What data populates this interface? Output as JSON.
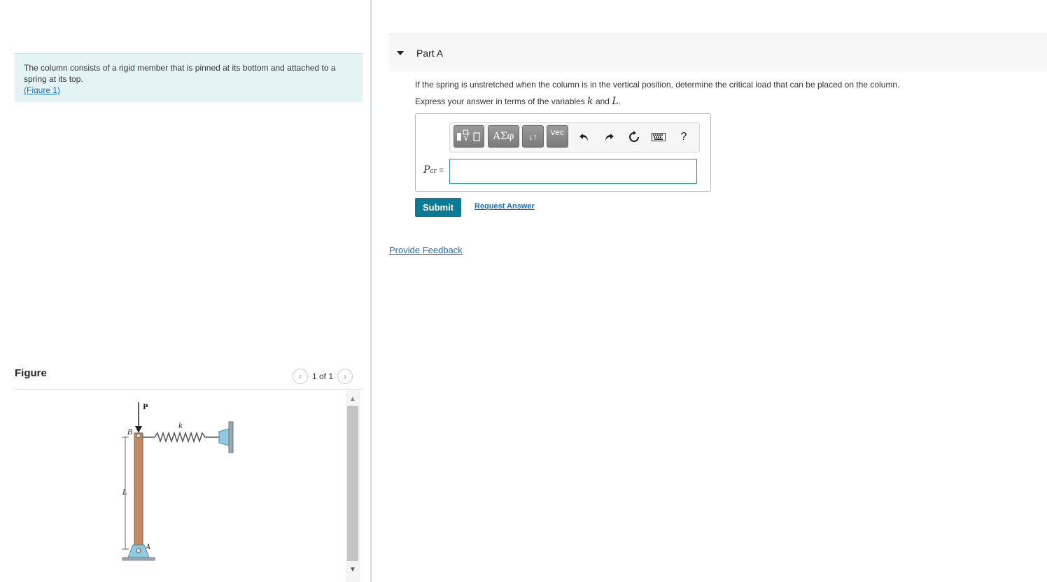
{
  "problem": {
    "text": "The column consists of a rigid member that is pinned at its bottom and attached to a spring at its top.",
    "figure_link": "(Figure 1)"
  },
  "figure": {
    "title": "Figure",
    "page_indicator": "1 of 1",
    "labels": {
      "P": "P",
      "B": "B",
      "k": "k",
      "L": "L",
      "A": "A"
    }
  },
  "part": {
    "title": "Part A",
    "question": "If the spring is unstretched when the column is in the vertical position, determine the critical load that can be placed on the column.",
    "express_prefix": "Express your answer in terms of the variables",
    "var1": "k",
    "and_word": "and",
    "var2": "L",
    "period": ".",
    "answer_label_P": "P",
    "answer_label_sub": "cr",
    "answer_label_eq": " =",
    "answer_value": ""
  },
  "toolbar": {
    "templates_icon": "sqrt-template-icon",
    "greek_label": "ΑΣφ",
    "arrows_label": "↓↑",
    "vec_label": "vec",
    "undo_icon": "undo-icon",
    "redo_icon": "redo-icon",
    "reset_icon": "reset-icon",
    "keyboard_icon": "keyboard-icon",
    "help_label": "?"
  },
  "actions": {
    "submit": "Submit",
    "request_answer": "Request Answer",
    "provide_feedback": "Provide Feedback"
  },
  "colors": {
    "accent": "#0b7a94",
    "link": "#1a6fb0",
    "problem_bg": "#e4f4f4"
  }
}
